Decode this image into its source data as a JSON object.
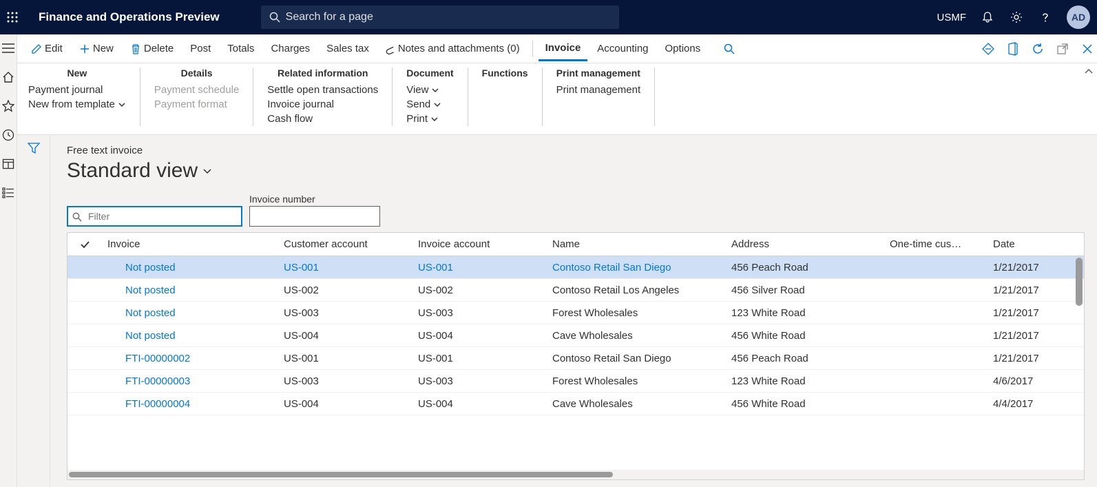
{
  "header": {
    "title": "Finance and Operations Preview",
    "search_placeholder": "Search for a page",
    "entity": "USMF",
    "avatar": "AD"
  },
  "actionbar": {
    "edit": "Edit",
    "new": "New",
    "delete": "Delete",
    "post": "Post",
    "totals": "Totals",
    "charges": "Charges",
    "salestax": "Sales tax",
    "notes": "Notes and attachments (0)",
    "tabs": {
      "invoice": "Invoice",
      "accounting": "Accounting",
      "options": "Options"
    }
  },
  "ribbon": {
    "new": {
      "title": "New",
      "payment_journal": "Payment journal",
      "new_from_template": "New from template"
    },
    "details": {
      "title": "Details",
      "payment_schedule": "Payment schedule",
      "payment_format": "Payment format"
    },
    "related": {
      "title": "Related information",
      "settle": "Settle open transactions",
      "journal": "Invoice journal",
      "cashflow": "Cash flow"
    },
    "document": {
      "title": "Document",
      "view": "View",
      "send": "Send",
      "print": "Print"
    },
    "functions": {
      "title": "Functions"
    },
    "printmgmt": {
      "title": "Print management",
      "item": "Print management"
    }
  },
  "content": {
    "breadcrumb": "Free text invoice",
    "viewname": "Standard view",
    "filter_placeholder": "Filter",
    "invoice_number_label": "Invoice number"
  },
  "grid": {
    "headers": {
      "invoice": "Invoice",
      "customer_account": "Customer account",
      "invoice_account": "Invoice account",
      "name": "Name",
      "address": "Address",
      "onetime": "One-time cus…",
      "date": "Date"
    },
    "rows": [
      {
        "invoice": "Not posted",
        "cust": "US-001",
        "invacct": "US-001",
        "name": "Contoso Retail San Diego",
        "addr": "456 Peach Road",
        "date": "1/21/2017",
        "selected": true,
        "linkall": true
      },
      {
        "invoice": "Not posted",
        "cust": "US-002",
        "invacct": "US-002",
        "name": "Contoso Retail Los Angeles",
        "addr": "456 Silver Road",
        "date": "1/21/2017"
      },
      {
        "invoice": "Not posted",
        "cust": "US-003",
        "invacct": "US-003",
        "name": "Forest Wholesales",
        "addr": "123 White Road",
        "date": "1/21/2017"
      },
      {
        "invoice": "Not posted",
        "cust": "US-004",
        "invacct": "US-004",
        "name": "Cave Wholesales",
        "addr": "456 White Road",
        "date": "1/21/2017"
      },
      {
        "invoice": "FTI-00000002",
        "cust": "US-001",
        "invacct": "US-001",
        "name": "Contoso Retail San Diego",
        "addr": "456 Peach Road",
        "date": "1/21/2017"
      },
      {
        "invoice": "FTI-00000003",
        "cust": "US-003",
        "invacct": "US-003",
        "name": "Forest Wholesales",
        "addr": "123 White Road",
        "date": "4/6/2017"
      },
      {
        "invoice": "FTI-00000004",
        "cust": "US-004",
        "invacct": "US-004",
        "name": "Cave Wholesales",
        "addr": "456 White Road",
        "date": "4/4/2017"
      }
    ]
  }
}
